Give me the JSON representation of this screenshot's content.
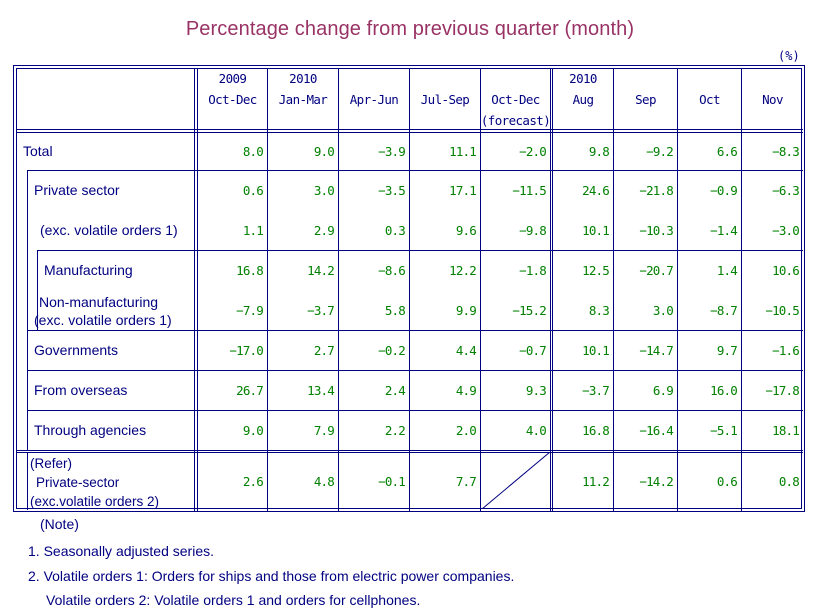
{
  "title": "Percentage change from previous quarter (month)",
  "unit": "(%)",
  "table": {
    "columns": [
      {
        "line1": "2009",
        "line2": "Oct-Dec",
        "line3": ""
      },
      {
        "line1": "2010",
        "line2": "Jan-Mar",
        "line3": ""
      },
      {
        "line1": "",
        "line2": "Apr-Jun",
        "line3": ""
      },
      {
        "line1": "",
        "line2": "Jul-Sep",
        "line3": ""
      },
      {
        "line1": "",
        "line2": "Oct-Dec",
        "line3": "(forecast)"
      },
      {
        "line1": "2010",
        "line2": "Aug",
        "line3": ""
      },
      {
        "line1": "",
        "line2": "Sep",
        "line3": ""
      },
      {
        "line1": "",
        "line2": "Oct",
        "line3": ""
      },
      {
        "line1": "",
        "line2": "Nov",
        "line3": ""
      }
    ],
    "rows": [
      {
        "label": "Total",
        "values": [
          "8.0",
          "9.0",
          "-3.9",
          "11.1",
          "-2.0",
          "9.8",
          "-9.2",
          "6.6",
          "-8.3"
        ]
      },
      {
        "label": "Private sector",
        "values": [
          "0.6",
          "3.0",
          "-3.5",
          "17.1",
          "-11.5",
          "24.6",
          "-21.8",
          "-0.9",
          "-6.3"
        ]
      },
      {
        "label": "(exc. volatile orders 1)",
        "values": [
          "1.1",
          "2.9",
          "0.3",
          "9.6",
          "-9.8",
          "10.1",
          "-10.3",
          "-1.4",
          "-3.0"
        ]
      },
      {
        "label": "Manufacturing",
        "values": [
          "16.8",
          "14.2",
          "-8.6",
          "12.2",
          "-1.8",
          "12.5",
          "-20.7",
          "1.4",
          "10.6"
        ]
      },
      {
        "label": "Non-manufacturing",
        "label2": "(exc. volatile orders 1)",
        "values": [
          "-7.9",
          "-3.7",
          "5.8",
          "9.9",
          "-15.2",
          "8.3",
          "3.0",
          "-8.7",
          "-10.5"
        ]
      },
      {
        "label": "Governments",
        "values": [
          "-17.0",
          "2.7",
          "-0.2",
          "4.4",
          "-0.7",
          "10.1",
          "-14.7",
          "9.7",
          "-1.6"
        ]
      },
      {
        "label": "From overseas",
        "values": [
          "26.7",
          "13.4",
          "2.4",
          "4.9",
          "9.3",
          "-3.7",
          "6.9",
          "16.0",
          "-17.8"
        ]
      },
      {
        "label": "Through agencies",
        "values": [
          "9.0",
          "7.9",
          "2.2",
          "2.0",
          "4.0",
          "16.8",
          "-16.4",
          "-5.1",
          "18.1"
        ]
      },
      {
        "label": "(Refer)",
        "label2": "Private-sector",
        "label3": "(exc.volatile orders 2)",
        "values": [
          "2.6",
          "4.8",
          "-0.1",
          "7.7",
          "",
          "11.2",
          "-14.2",
          "0.6",
          "0.8"
        ]
      }
    ]
  },
  "notes": {
    "heading": "(Note)",
    "item1": "1. Seasonally adjusted series.",
    "item2_key": "2. Volatile orders 1",
    "item2_text": "Orders for ships and those from electric power companies.",
    "item3_key": "Volatile orders 2",
    "item3_text": "Volatile orders 1 and orders for cellphones."
  }
}
